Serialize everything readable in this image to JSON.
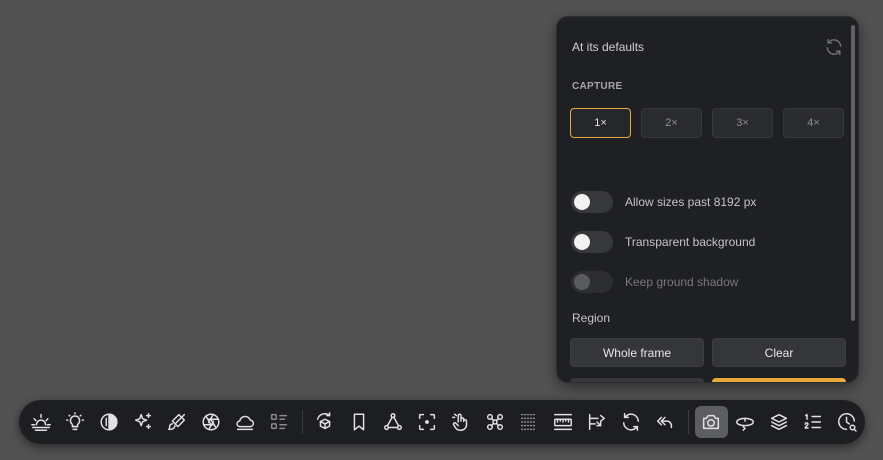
{
  "panel": {
    "title": "At its defaults",
    "section_label": "CAPTURE",
    "scales": [
      {
        "label": "1×",
        "active": true
      },
      {
        "label": "2×",
        "active": false
      },
      {
        "label": "3×",
        "active": false
      },
      {
        "label": "4×",
        "active": false
      }
    ],
    "toggles": {
      "allow_sizes": {
        "label": "Allow sizes past 8192 px",
        "on": false
      },
      "transparent_bg": {
        "label": "Transparent background",
        "on": false
      },
      "ground_shadow": {
        "label": "Keep ground shadow",
        "on": false,
        "disabled": true
      }
    },
    "region_label": "Region",
    "region_buttons": {
      "whole_frame": "Whole frame",
      "clear": "Clear"
    }
  },
  "colors": {
    "accent": "#e8a83a",
    "panel_bg": "#1f2023",
    "canvas_bg": "#525252"
  },
  "toolbar": {
    "tools": [
      "sunrise-icon",
      "lightbulb-icon",
      "contrast-icon",
      "sparkles-icon",
      "brush-icon",
      "aperture-icon",
      "cloud-icon",
      "list-grid-icon",
      "rotate-cube-icon",
      "bookmark-icon",
      "vector-nodes-icon",
      "focus-point-icon",
      "hand-pointer-icon",
      "drone-icon",
      "dotted-grid-icon",
      "ruler-icon",
      "route-arrow-icon",
      "refresh-icon",
      "undo-icon",
      "camera-icon",
      "orbit-icon",
      "layers-icon",
      "numbered-list-icon",
      "clock-search-icon"
    ],
    "active_tool": "camera-icon"
  }
}
